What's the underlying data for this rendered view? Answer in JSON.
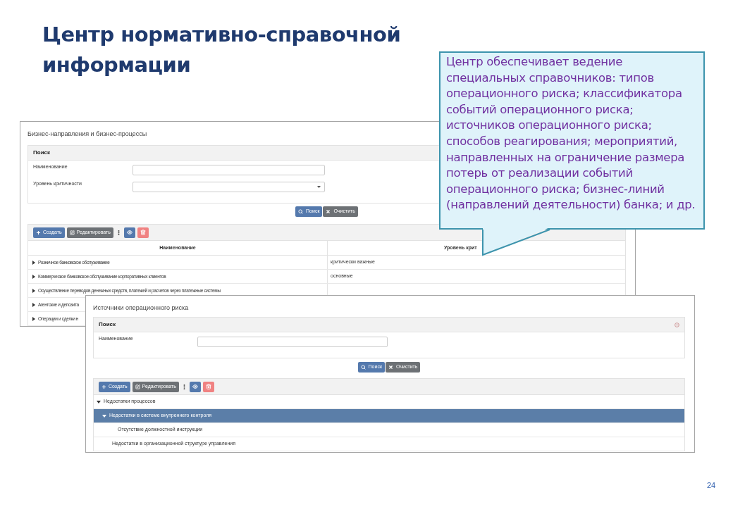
{
  "slide_title": "Центр нормативно-справочной информации",
  "callout": {
    "text": "Центр обеспечивает ведение специальных справочников: типов операционного риска; классификатора событий операционного риска; источников операционного риска; способов реагирования; мероприятий, направленных на ограничение размера потерь от реализации событий операционного риска; бизнес-линий (направлений деятельности) банка; и др."
  },
  "window_1": {
    "title": "Бизнес-направления и бизнес-процессы",
    "search_panel": {
      "title": "Поиск",
      "fields": [
        {
          "kind": "text",
          "label": "Наименование"
        },
        {
          "kind": "select",
          "label": "Уровень критичности"
        }
      ]
    },
    "search_buttons": [
      {
        "kind": "search",
        "label": "Поиск"
      },
      {
        "kind": "clear",
        "label": "Очистить"
      }
    ],
    "toolbar": [
      {
        "kind": "create",
        "label": "Создать"
      },
      {
        "kind": "edit",
        "label": "Редактировать"
      },
      {
        "kind": "more"
      },
      {
        "kind": "view"
      },
      {
        "kind": "delete"
      }
    ],
    "table": {
      "columns": [
        "Наименование",
        "Уровень крит"
      ],
      "rows": [
        {
          "name": "Розничное банковское обслуживание",
          "level": "критически важные",
          "expanded": false
        },
        {
          "name": "Коммерческое банковское обслуживание корпоративных клиентов",
          "level": "основные",
          "expanded": false
        },
        {
          "name": "Осуществление переводов денежных средств, платежей и расчетов через платежные системы",
          "expanded": false
        },
        {
          "name": "Агентские и депозита",
          "expanded": false
        },
        {
          "name": "Операции и сделки н",
          "expanded": false
        }
      ]
    }
  },
  "window_2": {
    "title": "Источники операционного риска",
    "search_panel": {
      "title": "Поиск",
      "collapsible": true,
      "fields": [
        {
          "kind": "text",
          "label": "Наименование"
        }
      ]
    },
    "search_buttons": [
      {
        "kind": "search",
        "label": "Поиск"
      },
      {
        "kind": "clear",
        "label": "Очистить"
      }
    ],
    "toolbar": [
      {
        "kind": "create",
        "label": "Создать"
      },
      {
        "kind": "edit",
        "label": "Редактировать"
      },
      {
        "kind": "more"
      },
      {
        "kind": "view"
      },
      {
        "kind": "delete"
      }
    ],
    "tree": [
      {
        "label": "Недостатки процессов",
        "expanded": true,
        "selected": false,
        "children": [
          {
            "label": "Недостатки в системе внутреннего контроля",
            "expanded": true,
            "selected": true,
            "children": [
              {
                "label": "Отсутствие должностной инструкции",
                "selected": false
              }
            ]
          },
          {
            "label": "Недостатки в организационной структуре управления",
            "selected": false
          }
        ]
      }
    ]
  },
  "page_number": "24"
}
